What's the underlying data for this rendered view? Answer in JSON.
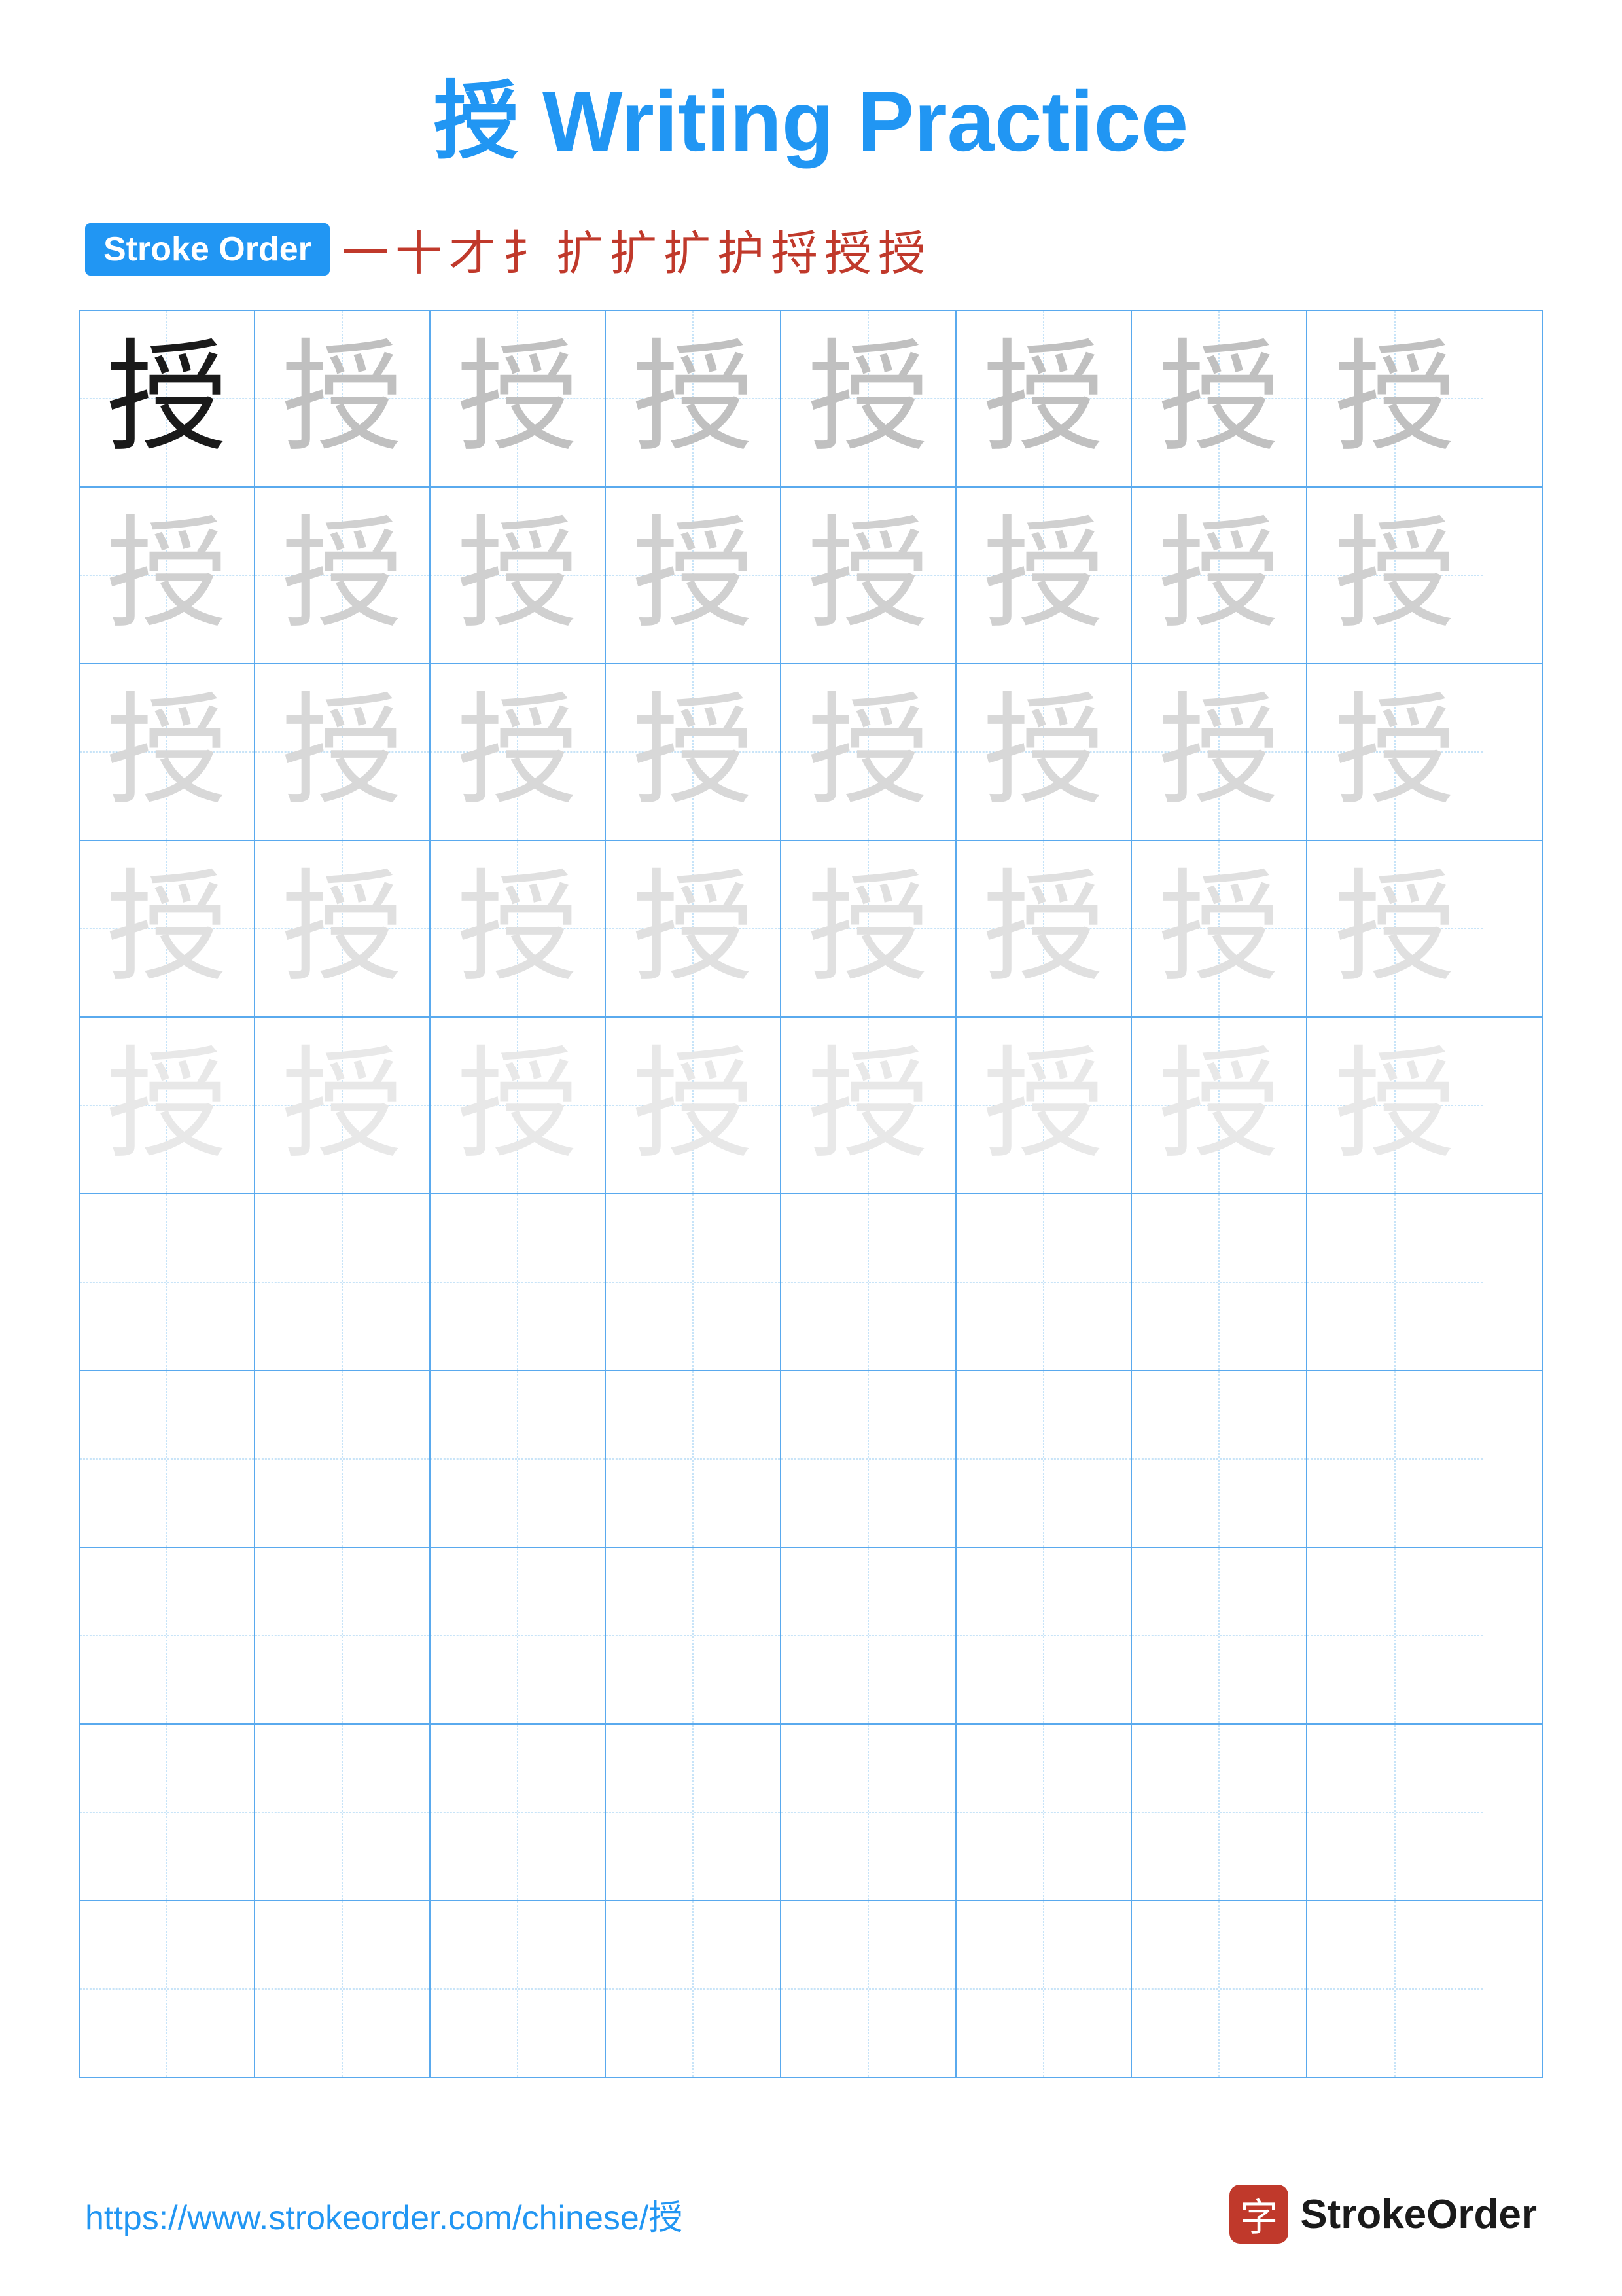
{
  "title": {
    "char": "授",
    "rest": " Writing Practice"
  },
  "stroke_order": {
    "badge_label": "Stroke Order",
    "chars": [
      "一",
      "十",
      "才",
      "扌",
      "扩",
      "扩",
      "扩",
      "护",
      "捋",
      "授",
      "授"
    ]
  },
  "grid": {
    "rows": 10,
    "cols": 8,
    "char": "授",
    "practice_rows": [
      [
        "dark",
        "light1",
        "light1",
        "light1",
        "light1",
        "light1",
        "light1",
        "light1"
      ],
      [
        "light2",
        "light2",
        "light2",
        "light2",
        "light2",
        "light2",
        "light2",
        "light2"
      ],
      [
        "light3",
        "light3",
        "light3",
        "light3",
        "light3",
        "light3",
        "light3",
        "light3"
      ],
      [
        "light4",
        "light4",
        "light4",
        "light4",
        "light4",
        "light4",
        "light4",
        "light4"
      ],
      [
        "light5",
        "light5",
        "light5",
        "light5",
        "light5",
        "light5",
        "light5",
        "light5"
      ],
      [
        "empty",
        "empty",
        "empty",
        "empty",
        "empty",
        "empty",
        "empty",
        "empty"
      ],
      [
        "empty",
        "empty",
        "empty",
        "empty",
        "empty",
        "empty",
        "empty",
        "empty"
      ],
      [
        "empty",
        "empty",
        "empty",
        "empty",
        "empty",
        "empty",
        "empty",
        "empty"
      ],
      [
        "empty",
        "empty",
        "empty",
        "empty",
        "empty",
        "empty",
        "empty",
        "empty"
      ],
      [
        "empty",
        "empty",
        "empty",
        "empty",
        "empty",
        "empty",
        "empty",
        "empty"
      ]
    ]
  },
  "footer": {
    "url": "https://www.strokeorder.com/chinese/授",
    "logo_char": "字",
    "logo_name": "StrokeOrder"
  }
}
